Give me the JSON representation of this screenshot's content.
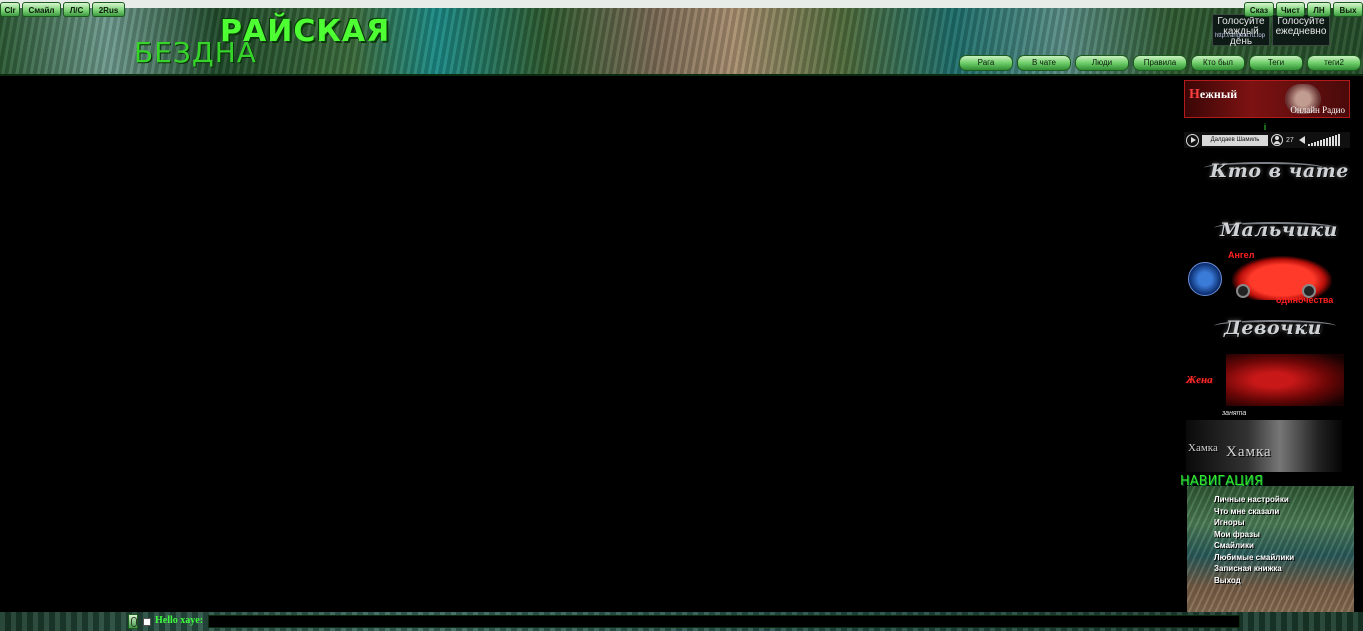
{
  "header": {
    "logo_top": "РАЙСКАЯ",
    "logo_bottom": "БЕЗДНА",
    "vote_left": "Голосуйте каждый день",
    "vote_right": "Голосуйте ежедневно",
    "vote_url": "http://angeal.ru.top",
    "tabs": [
      "Рага",
      "В чате",
      "Люди",
      "Правила",
      "Кто был",
      "Теги",
      "теги2"
    ]
  },
  "radio": {
    "title_first": "Н",
    "title_rest": "ежный",
    "subtitle": "Онлайн Радио",
    "indicator": "i",
    "track": "Далдаев Шамиль",
    "listeners": "27",
    "volume_level": 0.9
  },
  "sidebar": {
    "who_in_chat": "Кто в чате",
    "boys": "Мальчики",
    "boy_name": "Ангел",
    "boy_status": "одиночества",
    "girls": "Девочки",
    "girl_tag": "Жена",
    "girl_status": "занята",
    "hamka_small": "Хамка",
    "hamka_big": "Хамка"
  },
  "navigation": {
    "header": "НАВИГАЦИЯ",
    "links": [
      "Личные настройки",
      "Что мне сказали",
      "Игноры",
      "Мои фразы",
      "Смайлики",
      "Любимые смайлики",
      "Записная книжка",
      "Выход"
    ]
  },
  "bottom": {
    "left_buttons": [
      "Clr",
      "Смайл",
      "Л/С",
      "2Rus"
    ],
    "hello": "Hello xaye:",
    "right_buttons": [
      "Сказ",
      "Чист",
      "ЛН",
      "Вых"
    ],
    "message_value": ""
  },
  "colors": {
    "background": "#000000",
    "accent_green": "#3fff3f",
    "accent_red": "#ff2020"
  }
}
